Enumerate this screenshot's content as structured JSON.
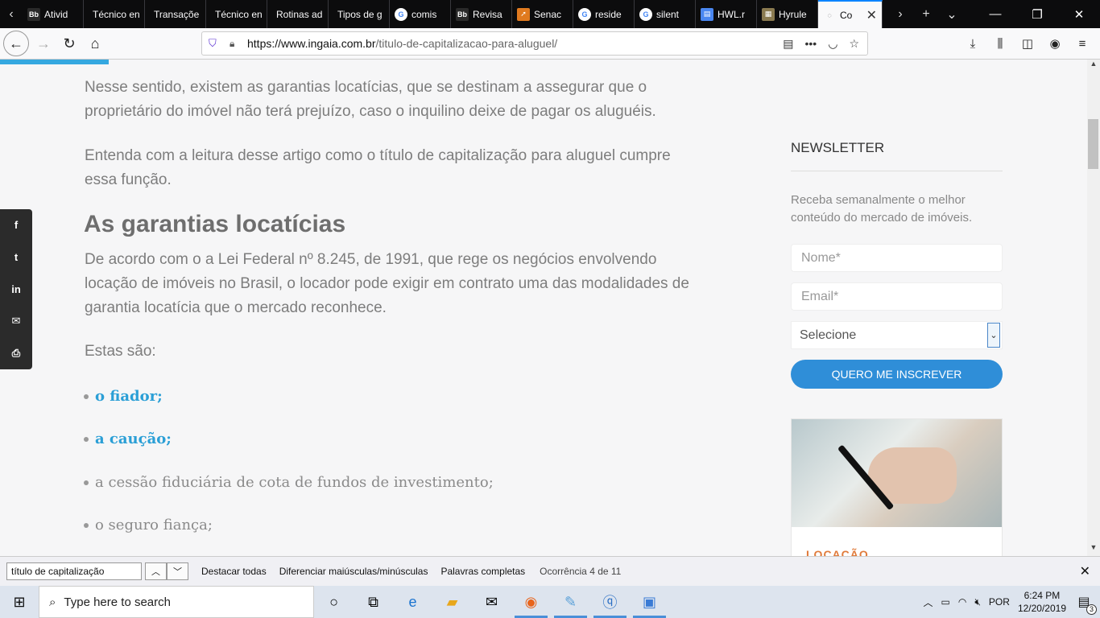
{
  "browser": {
    "tabs": [
      {
        "label": "Ativid",
        "icon": "bb-icon",
        "icon_text": "Bb",
        "color": "#2a2a2a"
      },
      {
        "label": "Técnico en",
        "icon": "none",
        "icon_text": "",
        "color": ""
      },
      {
        "label": "Transaçõe",
        "icon": "none",
        "icon_text": "",
        "color": ""
      },
      {
        "label": "Técnico en",
        "icon": "none",
        "icon_text": "",
        "color": ""
      },
      {
        "label": "Rotinas ad",
        "icon": "none",
        "icon_text": "",
        "color": ""
      },
      {
        "label": "Tipos de g",
        "icon": "none",
        "icon_text": "",
        "color": ""
      },
      {
        "label": "comis",
        "icon": "google-icon",
        "icon_text": "G",
        "color": "#ffffff"
      },
      {
        "label": "Revisa",
        "icon": "bb-icon",
        "icon_text": "Bb",
        "color": "#2a2a2a"
      },
      {
        "label": "Senac",
        "icon": "senac-icon",
        "icon_text": "➚",
        "color": "#e07a1f"
      },
      {
        "label": "reside",
        "icon": "google-icon",
        "icon_text": "G",
        "color": "#ffffff"
      },
      {
        "label": "silent",
        "icon": "google-icon",
        "icon_text": "G",
        "color": "#ffffff"
      },
      {
        "label": "HWL.r",
        "icon": "doc-icon",
        "icon_text": "▤",
        "color": "#4a87f0"
      },
      {
        "label": "Hyrule",
        "icon": "game-icon",
        "icon_text": "▦",
        "color": "#8a7a50"
      }
    ],
    "active_tab": {
      "label": "Co",
      "close": "✕"
    },
    "url_domain": "https://www.ingaia.com.br",
    "url_path": "/titulo-de-capitalizacao-para-aluguel/"
  },
  "article": {
    "p1": "Nesse sentido, existem as garantias locatícias, que se destinam a assegurar que o proprietário do imóvel não terá prejuízo, caso o inquilino deixe de pagar os aluguéis.",
    "p2": "Entenda com a leitura desse artigo como o título de capitalização para aluguel cumpre essa função.",
    "heading": "As garantias locatícias",
    "p3": "De acordo com o a Lei Federal nº 8.245, de 1991, que rege os negócios envolvendo locação de imóveis no Brasil, o locador pode exigir em contrato uma das modalidades de garantia locatícia que o mercado reconhece.",
    "p4": "Estas são:",
    "list": [
      "o fiador;",
      "a caução;",
      "a cessão fiduciária de cota de fundos de investimento;",
      "o seguro fiança;"
    ]
  },
  "share": {
    "items": [
      "f",
      "t",
      "in",
      "✉",
      "⎙"
    ]
  },
  "newsletter": {
    "title": "NEWSLETTER",
    "desc": "Receba semanalmente o melhor conteúdo do mercado de imóveis.",
    "name_placeholder": "Nome*",
    "email_placeholder": "Email*",
    "select_value": "Selecione",
    "button": "QUERO ME INSCREVER"
  },
  "card": {
    "title": "LOCAÇÃO"
  },
  "findbar": {
    "query": "título de capitalização",
    "highlight": "Destacar todas",
    "match_case": "Diferenciar maiúsculas/minúsculas",
    "whole_words": "Palavras completas",
    "status": "Ocorrência 4 de 11"
  },
  "taskbar": {
    "search_placeholder": "Type here to search",
    "lang": "POR",
    "time": "6:24 PM",
    "date": "12/20/2019",
    "notifications": "3"
  },
  "colors": {
    "accent": "#2f8ed8",
    "link": "#2b9fd6",
    "progress": "#35a8e0"
  }
}
